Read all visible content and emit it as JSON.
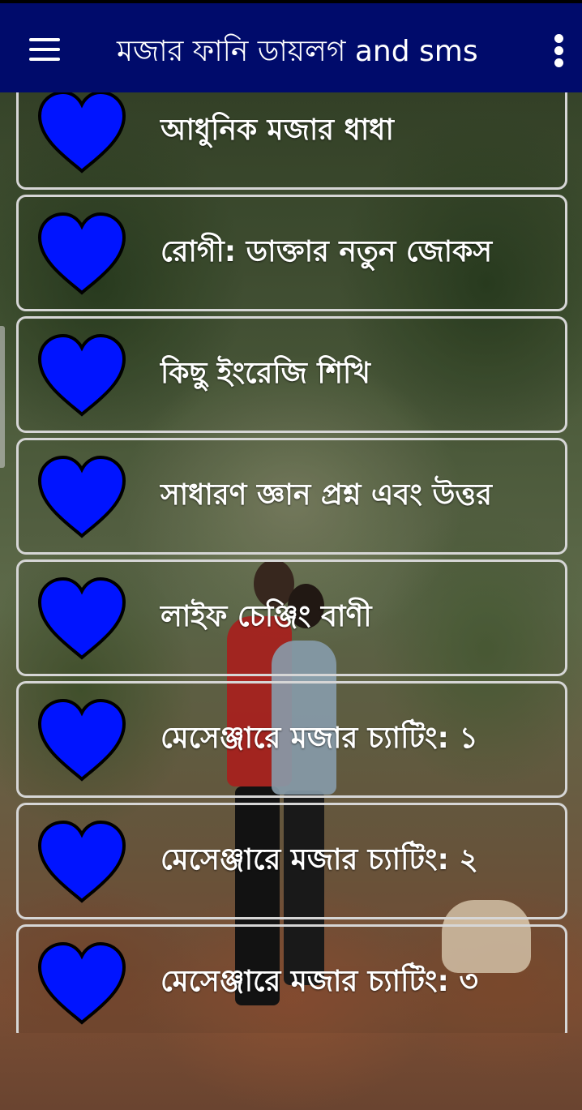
{
  "app_bar": {
    "title": "মজার ফানি ডায়লগ and sms",
    "background_color": "#000b6b",
    "menu_icon": "hamburger-menu-icon",
    "overflow_icon": "more-vertical-icon"
  },
  "list": {
    "heart_color": "#0014ff",
    "items": [
      {
        "label": "আধুনিক মজার ধাধা",
        "icon": "heart-icon"
      },
      {
        "label": "রোগী: ডাক্তার নতুন জোকস",
        "icon": "heart-icon"
      },
      {
        "label": "কিছু ইংরেজি শিখি",
        "icon": "heart-icon"
      },
      {
        "label": "সাধারণ জ্ঞান প্রশ্ন এবং উত্তর",
        "icon": "heart-icon"
      },
      {
        "label": "লাইফ চেঞ্জিং বাণী",
        "icon": "heart-icon"
      },
      {
        "label": "মেসেঞ্জারে মজার চ্যাটিং: ১",
        "icon": "heart-icon"
      },
      {
        "label": "মেসেঞ্জারে মজার চ্যাটিং: ২",
        "icon": "heart-icon"
      },
      {
        "label": "মেসেঞ্জারে মজার চ্যাটিং: ৩",
        "icon": "heart-icon"
      }
    ]
  }
}
